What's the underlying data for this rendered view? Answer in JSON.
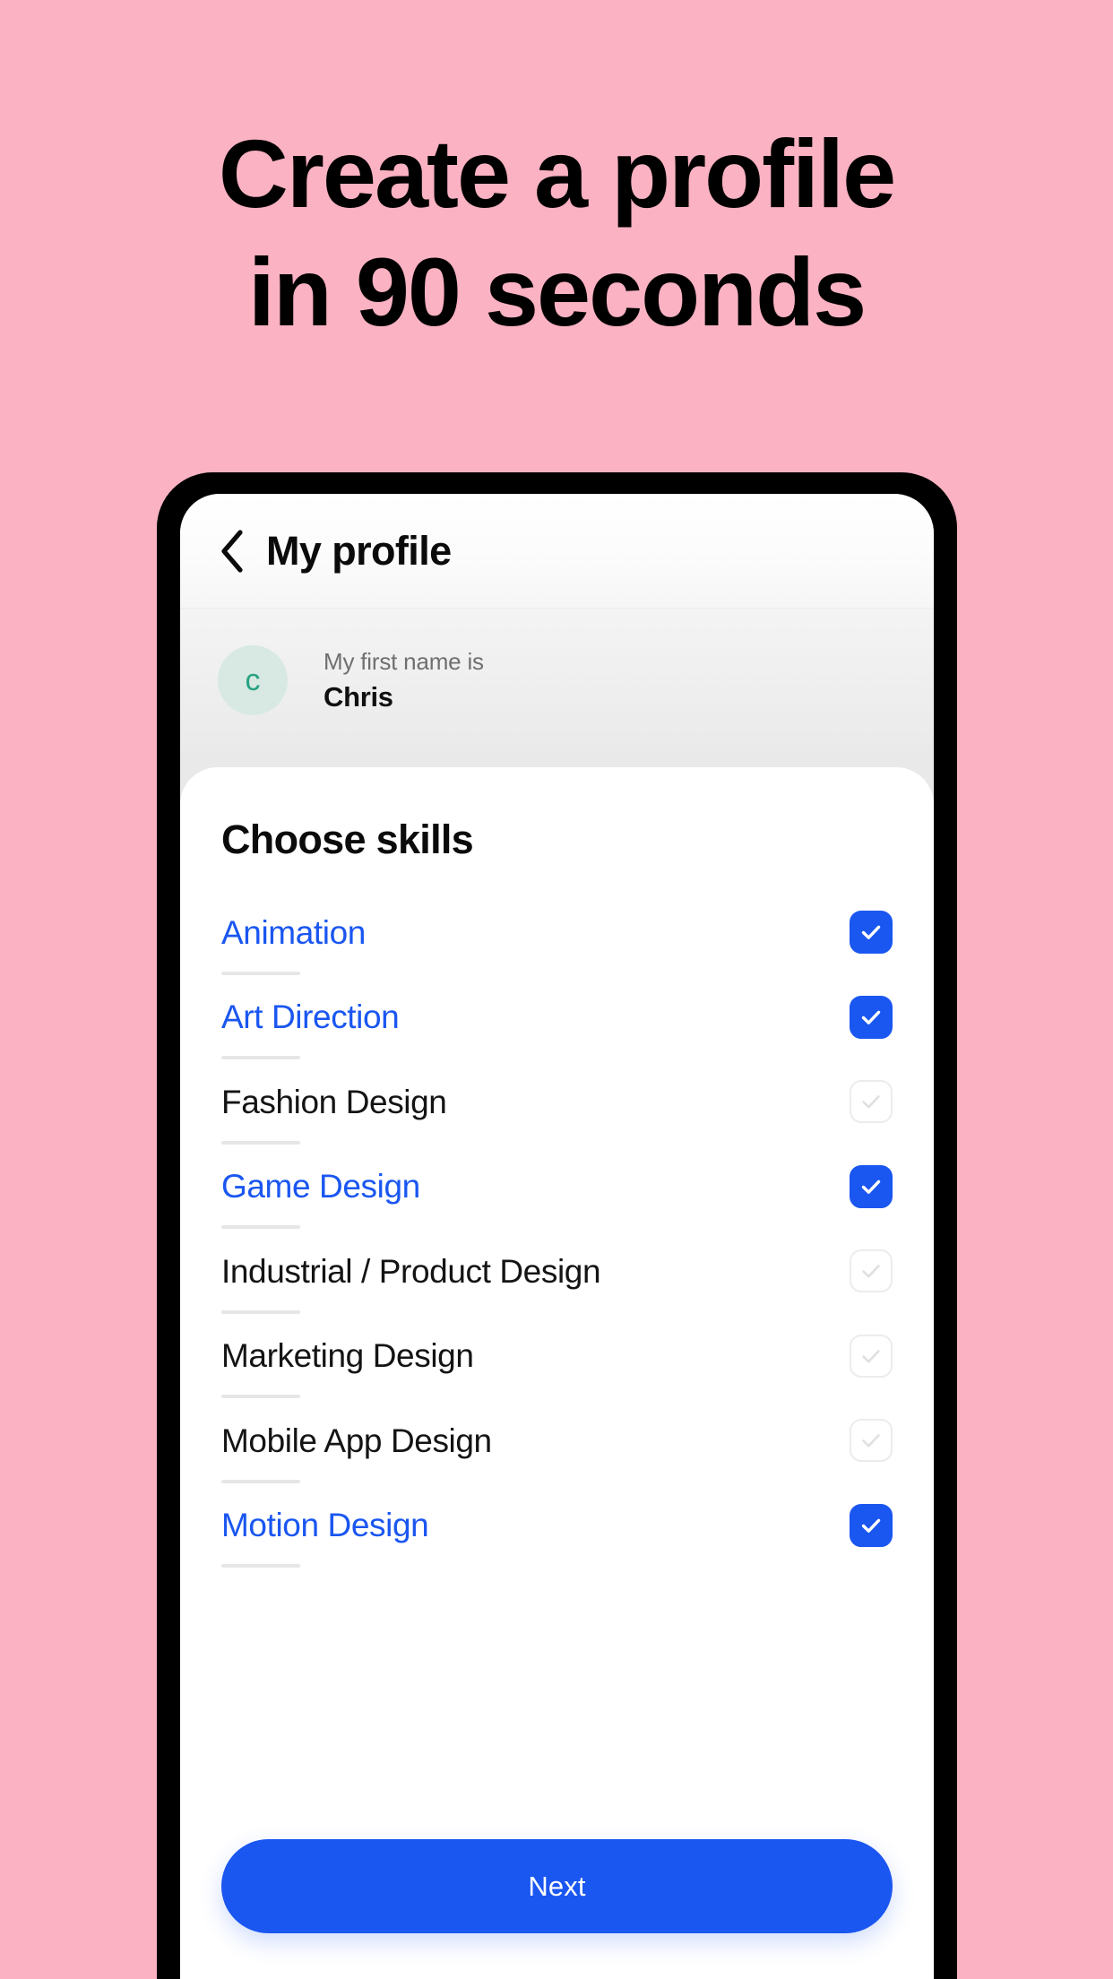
{
  "promo": {
    "background_color": "#FBB2C2",
    "headline_line1": "Create a profile",
    "headline_line2": "in 90 seconds"
  },
  "app": {
    "navbar": {
      "back_icon": "chevron-left-icon",
      "title": "My profile"
    },
    "profile_summary": {
      "avatar_initial": "c",
      "avatar_bg_color": "#d7e9e2",
      "avatar_text_color": "#28a382",
      "label": "My first name is",
      "value": "Chris"
    },
    "sheet": {
      "title": "Choose skills",
      "skills": [
        {
          "label": "Animation",
          "selected": true
        },
        {
          "label": "Art Direction",
          "selected": true
        },
        {
          "label": "Fashion Design",
          "selected": false
        },
        {
          "label": "Game Design",
          "selected": true
        },
        {
          "label": "Industrial / Product Design",
          "selected": false
        },
        {
          "label": "Marketing Design",
          "selected": false
        },
        {
          "label": "Mobile App Design",
          "selected": false
        },
        {
          "label": "Motion Design",
          "selected": true
        }
      ],
      "next_label": "Next",
      "accent_color": "#1A56F0"
    }
  }
}
